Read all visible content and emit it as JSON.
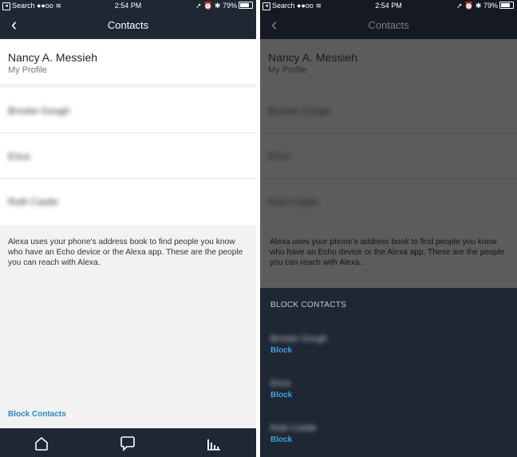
{
  "status_bar": {
    "back_app": "Search",
    "signal": "●●oo",
    "wifi": "≋",
    "time": "2:54 PM",
    "icons": "➚ ⏰ ✱",
    "battery": "79%"
  },
  "nav": {
    "back_symbol": "‹",
    "title": "Contacts"
  },
  "profile": {
    "name": "Nancy A. Messieh",
    "subtitle": "My Profile"
  },
  "contacts": [
    "Brooke Gough",
    "Erica",
    "Ruth Castle"
  ],
  "info_text": "Alexa uses your phone's address book to find people you know who have an Echo device or the Alexa app. These are the people you can reach with Alexa.",
  "block_contacts_link": "Block Contacts",
  "block_sheet": {
    "header": "BLOCK CONTACTS",
    "action_label": "Block",
    "items": [
      "Brooke Gough",
      "Erica",
      "Ruth Castle"
    ]
  },
  "bottom_tabs": [
    {
      "icon": "home-icon"
    },
    {
      "icon": "chat-bubble-icon"
    },
    {
      "icon": "activity-bars-icon"
    }
  ],
  "colors": {
    "nav_bg": "#1f2733",
    "link_blue": "#2f86c6",
    "block_blue": "#39a3e4",
    "dim_overlay": "#5c5c5c"
  }
}
